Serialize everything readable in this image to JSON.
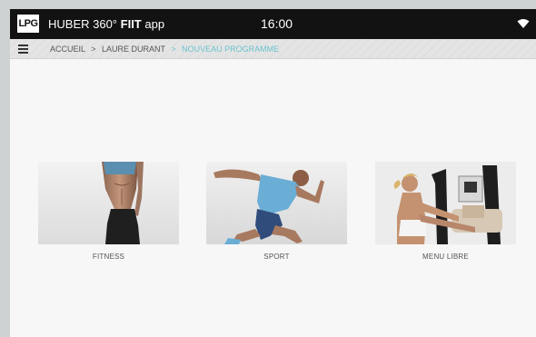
{
  "status_bar": {
    "logo_text": "LPG",
    "app_name": "HUBER 360°",
    "app_brand": "FIIT",
    "app_suffix": " app",
    "time": "16:00",
    "wifi_icon": "wifi-icon"
  },
  "breadcrumb": {
    "menu_icon": "hamburger-icon",
    "items": [
      "ACCUEIL",
      "LAURE DURANT",
      "NOUVEAU PROGRAMME"
    ],
    "separator": ">",
    "current_color": "#6cc4cf"
  },
  "programs": [
    {
      "label": "FITNESS"
    },
    {
      "label": "SPORT"
    },
    {
      "label": "MENU LIBRE"
    }
  ]
}
